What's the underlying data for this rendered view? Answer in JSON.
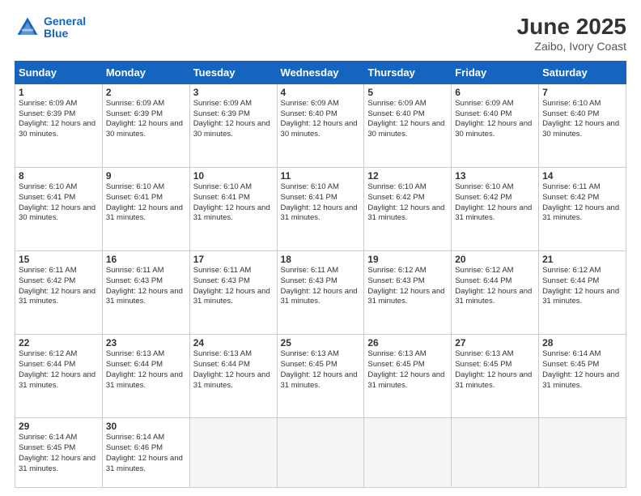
{
  "logo": {
    "line1": "General",
    "line2": "Blue"
  },
  "title": "June 2025",
  "subtitle": "Zaibo, Ivory Coast",
  "weekdays": [
    "Sunday",
    "Monday",
    "Tuesday",
    "Wednesday",
    "Thursday",
    "Friday",
    "Saturday"
  ],
  "weeks": [
    [
      {
        "day": "1",
        "sunrise": "6:09 AM",
        "sunset": "6:39 PM",
        "daylight": "12 hours and 30 minutes."
      },
      {
        "day": "2",
        "sunrise": "6:09 AM",
        "sunset": "6:39 PM",
        "daylight": "12 hours and 30 minutes."
      },
      {
        "day": "3",
        "sunrise": "6:09 AM",
        "sunset": "6:39 PM",
        "daylight": "12 hours and 30 minutes."
      },
      {
        "day": "4",
        "sunrise": "6:09 AM",
        "sunset": "6:40 PM",
        "daylight": "12 hours and 30 minutes."
      },
      {
        "day": "5",
        "sunrise": "6:09 AM",
        "sunset": "6:40 PM",
        "daylight": "12 hours and 30 minutes."
      },
      {
        "day": "6",
        "sunrise": "6:09 AM",
        "sunset": "6:40 PM",
        "daylight": "12 hours and 30 minutes."
      },
      {
        "day": "7",
        "sunrise": "6:10 AM",
        "sunset": "6:40 PM",
        "daylight": "12 hours and 30 minutes."
      }
    ],
    [
      {
        "day": "8",
        "sunrise": "6:10 AM",
        "sunset": "6:41 PM",
        "daylight": "12 hours and 30 minutes."
      },
      {
        "day": "9",
        "sunrise": "6:10 AM",
        "sunset": "6:41 PM",
        "daylight": "12 hours and 31 minutes."
      },
      {
        "day": "10",
        "sunrise": "6:10 AM",
        "sunset": "6:41 PM",
        "daylight": "12 hours and 31 minutes."
      },
      {
        "day": "11",
        "sunrise": "6:10 AM",
        "sunset": "6:41 PM",
        "daylight": "12 hours and 31 minutes."
      },
      {
        "day": "12",
        "sunrise": "6:10 AM",
        "sunset": "6:42 PM",
        "daylight": "12 hours and 31 minutes."
      },
      {
        "day": "13",
        "sunrise": "6:10 AM",
        "sunset": "6:42 PM",
        "daylight": "12 hours and 31 minutes."
      },
      {
        "day": "14",
        "sunrise": "6:11 AM",
        "sunset": "6:42 PM",
        "daylight": "12 hours and 31 minutes."
      }
    ],
    [
      {
        "day": "15",
        "sunrise": "6:11 AM",
        "sunset": "6:42 PM",
        "daylight": "12 hours and 31 minutes."
      },
      {
        "day": "16",
        "sunrise": "6:11 AM",
        "sunset": "6:43 PM",
        "daylight": "12 hours and 31 minutes."
      },
      {
        "day": "17",
        "sunrise": "6:11 AM",
        "sunset": "6:43 PM",
        "daylight": "12 hours and 31 minutes."
      },
      {
        "day": "18",
        "sunrise": "6:11 AM",
        "sunset": "6:43 PM",
        "daylight": "12 hours and 31 minutes."
      },
      {
        "day": "19",
        "sunrise": "6:12 AM",
        "sunset": "6:43 PM",
        "daylight": "12 hours and 31 minutes."
      },
      {
        "day": "20",
        "sunrise": "6:12 AM",
        "sunset": "6:44 PM",
        "daylight": "12 hours and 31 minutes."
      },
      {
        "day": "21",
        "sunrise": "6:12 AM",
        "sunset": "6:44 PM",
        "daylight": "12 hours and 31 minutes."
      }
    ],
    [
      {
        "day": "22",
        "sunrise": "6:12 AM",
        "sunset": "6:44 PM",
        "daylight": "12 hours and 31 minutes."
      },
      {
        "day": "23",
        "sunrise": "6:13 AM",
        "sunset": "6:44 PM",
        "daylight": "12 hours and 31 minutes."
      },
      {
        "day": "24",
        "sunrise": "6:13 AM",
        "sunset": "6:44 PM",
        "daylight": "12 hours and 31 minutes."
      },
      {
        "day": "25",
        "sunrise": "6:13 AM",
        "sunset": "6:45 PM",
        "daylight": "12 hours and 31 minutes."
      },
      {
        "day": "26",
        "sunrise": "6:13 AM",
        "sunset": "6:45 PM",
        "daylight": "12 hours and 31 minutes."
      },
      {
        "day": "27",
        "sunrise": "6:13 AM",
        "sunset": "6:45 PM",
        "daylight": "12 hours and 31 minutes."
      },
      {
        "day": "28",
        "sunrise": "6:14 AM",
        "sunset": "6:45 PM",
        "daylight": "12 hours and 31 minutes."
      }
    ],
    [
      {
        "day": "29",
        "sunrise": "6:14 AM",
        "sunset": "6:45 PM",
        "daylight": "12 hours and 31 minutes."
      },
      {
        "day": "30",
        "sunrise": "6:14 AM",
        "sunset": "6:46 PM",
        "daylight": "12 hours and 31 minutes."
      },
      null,
      null,
      null,
      null,
      null
    ]
  ]
}
